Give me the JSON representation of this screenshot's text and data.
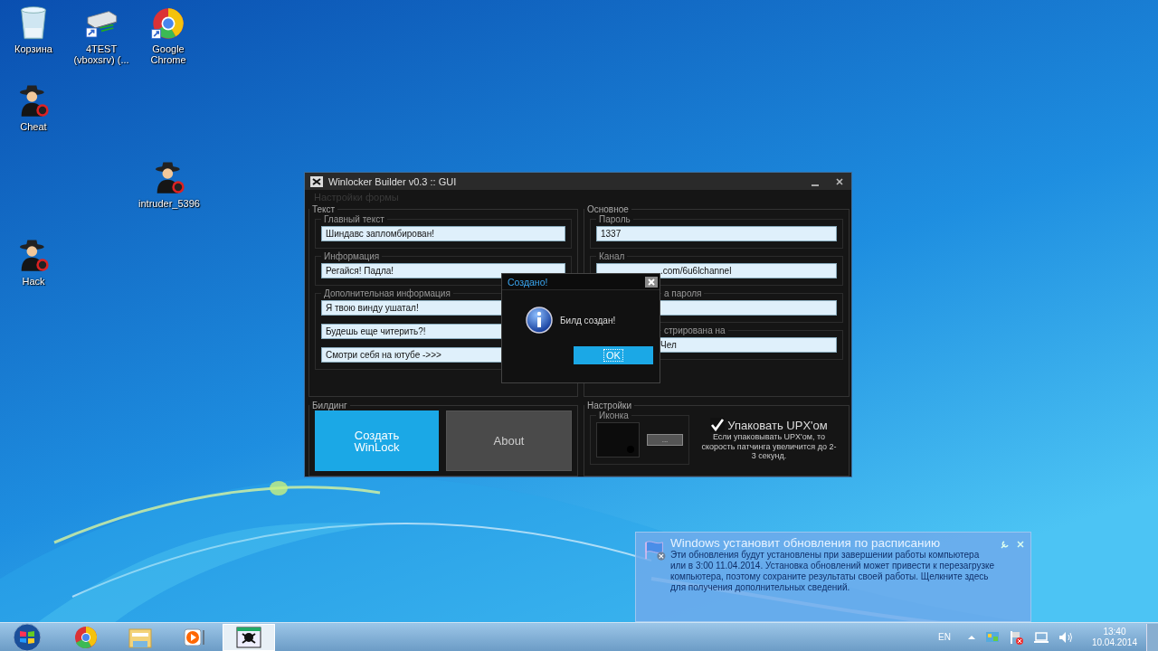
{
  "desktop_icons": [
    {
      "label": "Корзина",
      "kind": "bin"
    },
    {
      "label": "4TEST (vboxsrv) (...",
      "kind": "drive"
    },
    {
      "label": "Google Chrome",
      "kind": "chrome"
    },
    {
      "label": "Cheat",
      "kind": "figure"
    },
    {
      "label": "intruder_5396",
      "kind": "figure"
    },
    {
      "label": "Hack",
      "kind": "figure"
    }
  ],
  "window": {
    "title": "Winlocker Builder v0.3 :: GUI",
    "menu": "Настройки формы",
    "text_section": {
      "title": "Текст",
      "groups": [
        {
          "label": "Главный текст",
          "fields": [
            {
              "kind": "text",
              "value": "Шиндавс запломбирован!"
            }
          ]
        },
        {
          "label": "Информация",
          "fields": [
            {
              "kind": "text",
              "value": "Регайся! Падла!"
            }
          ]
        },
        {
          "label": "Дополнительная информация",
          "fields": [
            {
              "kind": "text",
              "value": "Я твою винду ушатал!"
            },
            {
              "kind": "text",
              "value": "Будешь еще читерить?!"
            },
            {
              "kind": "text",
              "value": "Смотри себя на ютубе ->>>"
            }
          ]
        }
      ]
    },
    "main_section": {
      "title": "Основное",
      "groups": [
        {
          "label": "Пароль",
          "fields": [
            {
              "kind": "text",
              "value": "1337"
            }
          ]
        },
        {
          "label": "Канал",
          "fields": [
            {
              "kind": "text",
              "value": ".com/6u6lchannel"
            }
          ]
        },
        {
          "label": "а пароля",
          "fields": [
            {
              "kind": "blank"
            }
          ]
        },
        {
          "label": "стрирована на",
          "fields": [
            {
              "kind": "text",
              "value": "Чел"
            }
          ]
        }
      ]
    },
    "building": {
      "title": "Билдинг",
      "buttons": [
        {
          "label": "Создать WinLock",
          "kind": "primary"
        },
        {
          "label": "About",
          "kind": "secondary"
        }
      ]
    },
    "settings": {
      "title": "Настройки",
      "icon_label": "Иконка",
      "browse_button": "...",
      "upx": {
        "label": "Упаковать UPX'ом",
        "checked": true
      },
      "note": "Если упаковывать UPX'ом, то скорость патчинга увеличится до 2-3 секунд."
    }
  },
  "dialog": {
    "title": "Создано!",
    "message": "Билд создан!",
    "button": "OK"
  },
  "notification": {
    "title": "Windows установит обновления по расписанию",
    "body": "Эти обновления будут установлены при завершении работы компьютера или в 3:00 11.04.2014. Установка обновлений может привести к перезагрузке компьютера, поэтому сохраните результаты своей работы. Щелкните здесь для получения дополнительных сведений."
  },
  "taskbar": {
    "apps": [
      {
        "kind": "chrome",
        "active": false
      },
      {
        "kind": "folder",
        "active": false
      },
      {
        "kind": "player",
        "active": false
      },
      {
        "kind": "skull",
        "active": true
      }
    ],
    "language": "EN",
    "time": "13:40",
    "date": "10.04.2014"
  }
}
